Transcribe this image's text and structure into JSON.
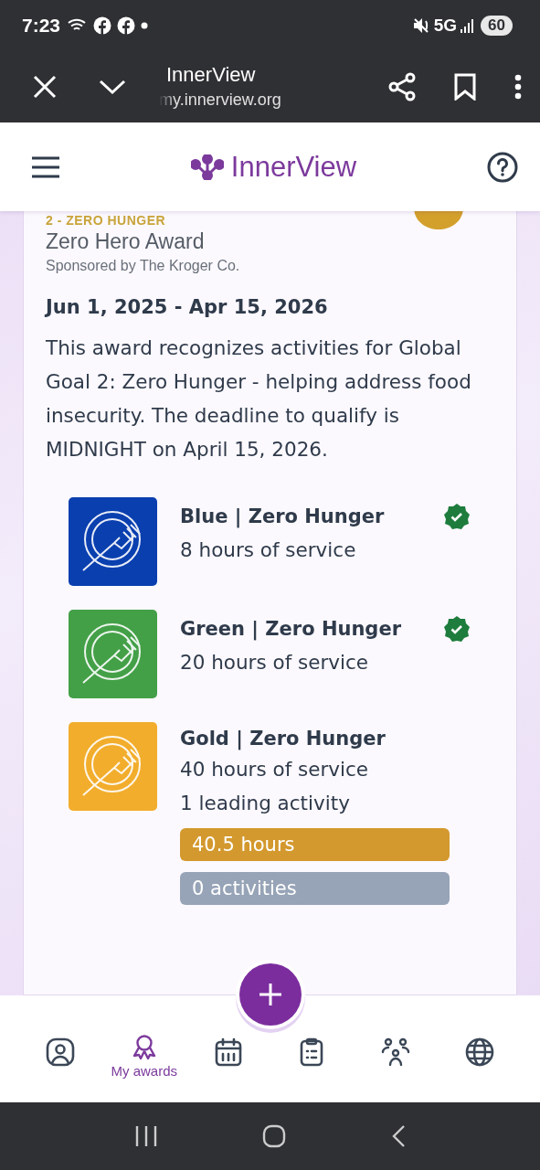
{
  "status_bar": {
    "time": "7:23",
    "network": "5G",
    "battery": "60"
  },
  "browser": {
    "title": "InnerView",
    "url": "my.innerview.org"
  },
  "app_header": {
    "brand": "InnerView"
  },
  "award": {
    "goal_label": "2 - ZERO HUNGER",
    "title": "Zero Hero Award",
    "sponsor": "Sponsored by The Kroger Co.",
    "dates": "Jun 1, 2025 - Apr 15, 2026",
    "description": "This award recognizes activities for Global Goal 2: Zero Hunger - helping address food insecurity. The deadline to qualify is MIDNIGHT on April 15, 2026.",
    "levels": [
      {
        "name": "Blue | Zero Hunger",
        "requirements": [
          "8 hours of service"
        ],
        "color": "#0a3fb0",
        "achieved": true
      },
      {
        "name": "Green | Zero Hunger",
        "requirements": [
          "20 hours of service"
        ],
        "color": "#43a047",
        "achieved": true
      },
      {
        "name": "Gold | Zero Hunger",
        "requirements": [
          "40 hours of service",
          "1 leading activity"
        ],
        "color": "#f2ad2c",
        "achieved": false,
        "progress": [
          {
            "text": "40.5 hours",
            "color": "#d4992e"
          },
          {
            "text": "0 activities",
            "color": "#97a4b7"
          }
        ]
      }
    ]
  },
  "bottom_nav": [
    {
      "kind": "profile",
      "selected": false
    },
    {
      "kind": "awards",
      "label": "My awards",
      "selected": true
    },
    {
      "kind": "calendar",
      "selected": false
    },
    {
      "kind": "clipboard",
      "selected": false
    },
    {
      "kind": "people",
      "selected": false
    },
    {
      "kind": "globe",
      "selected": false
    }
  ]
}
